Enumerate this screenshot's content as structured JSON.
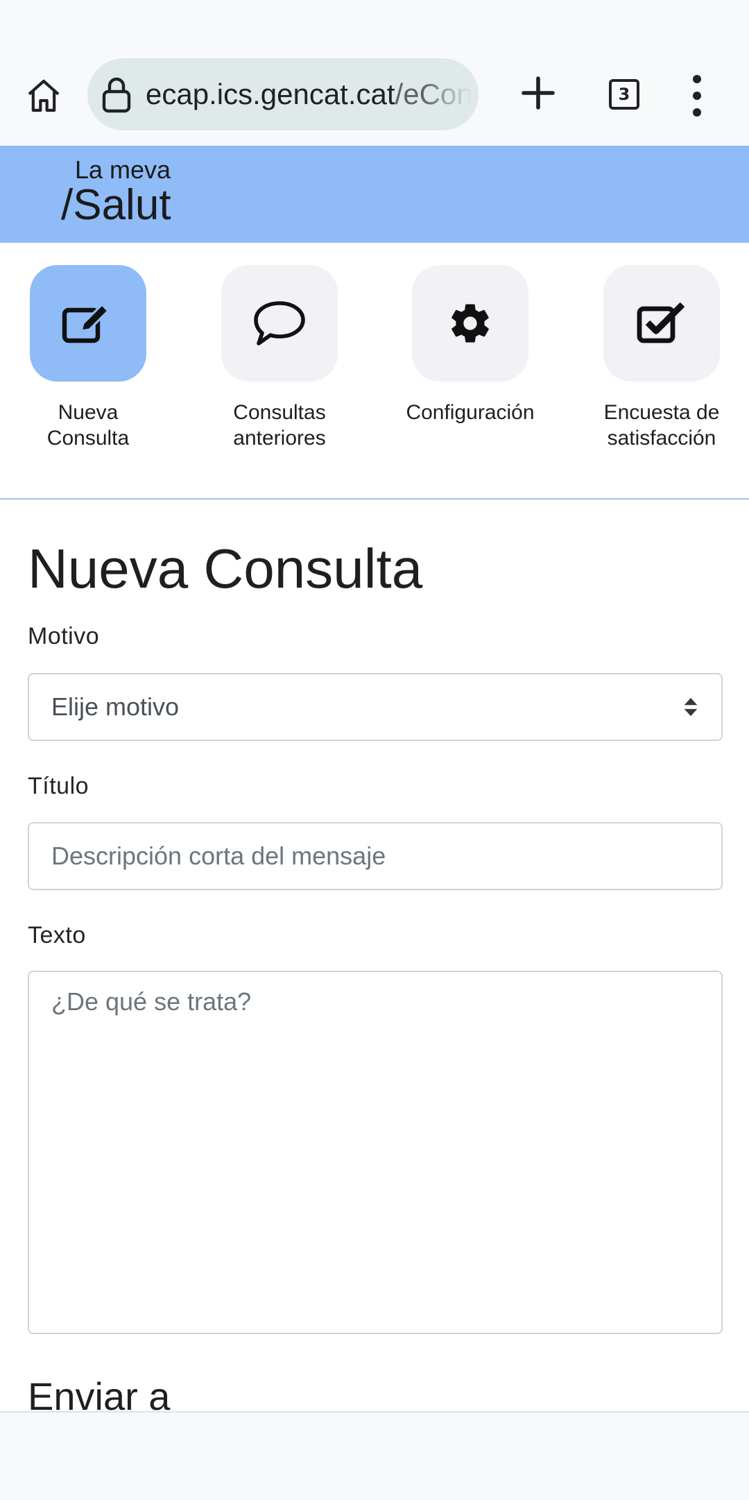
{
  "browser": {
    "url_host": "ecap.ics.gencat.cat",
    "url_path": "/eConsulta",
    "tab_count": "3",
    "icons": [
      "home-icon",
      "lock-icon",
      "plus-icon",
      "menu-dots-icon"
    ]
  },
  "header": {
    "logo_line1": "La meva",
    "logo_line2": "/Salut",
    "color": "#8fbbf7"
  },
  "nav": {
    "items": [
      {
        "label_line1": "Nueva",
        "label_line2": "Consulta",
        "icon": "edit-icon",
        "active": true
      },
      {
        "label_line1": "Consultas",
        "label_line2": "anteriores",
        "icon": "chat-icon",
        "active": false
      },
      {
        "label_line1": "Configuración",
        "label_line2": "",
        "icon": "gear-icon",
        "active": false
      },
      {
        "label_line1": "Encuesta de",
        "label_line2": "satisfacción",
        "icon": "checkbox-icon",
        "active": false
      }
    ]
  },
  "form": {
    "title": "Nueva Consulta",
    "motivo_label": "Motivo",
    "motivo_selected": "Elije motivo",
    "titulo_label": "Título",
    "titulo_placeholder": "Descripción corta del mensaje",
    "texto_label": "Texto",
    "texto_placeholder": "¿De qué se trata?",
    "enviar_heading": "Enviar a"
  }
}
